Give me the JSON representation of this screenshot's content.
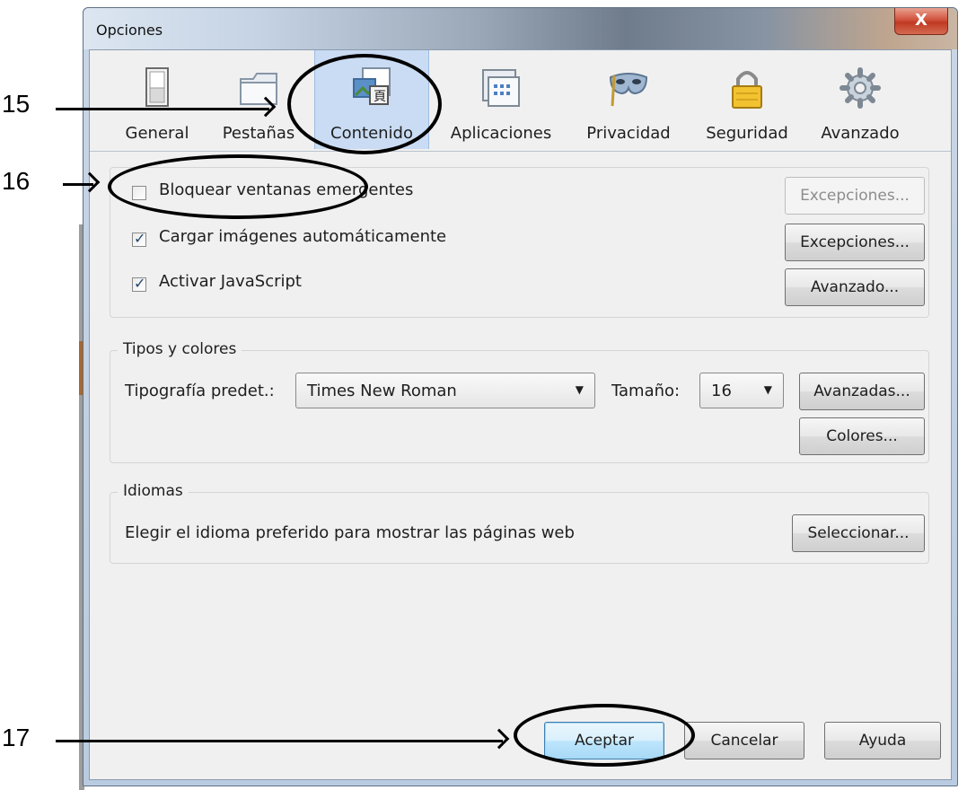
{
  "window": {
    "title": "Opciones",
    "close_glyph": "X"
  },
  "tabs": [
    {
      "label": "General",
      "icon": "general-switch-icon",
      "selected": false
    },
    {
      "label": "Pestañas",
      "icon": "tabs-folder-icon",
      "selected": false
    },
    {
      "label": "Contenido",
      "icon": "content-page-icon",
      "selected": true
    },
    {
      "label": "Aplicaciones",
      "icon": "applications-window-icon",
      "selected": false
    },
    {
      "label": "Privacidad",
      "icon": "privacy-mask-icon",
      "selected": false
    },
    {
      "label": "Seguridad",
      "icon": "security-lock-icon",
      "selected": false
    },
    {
      "label": "Avanzado",
      "icon": "advanced-gear-icon",
      "selected": false
    }
  ],
  "content": {
    "block_popups": {
      "label": "Bloquear ventanas emergentes",
      "checked": false,
      "button": "Excepciones..."
    },
    "load_images": {
      "label": "Cargar imágenes automáticamente",
      "checked": true,
      "button": "Excepciones..."
    },
    "enable_js": {
      "label": "Activar JavaScript",
      "checked": true,
      "button": "Avanzado..."
    }
  },
  "fonts": {
    "legend": "Tipos y colores",
    "default_font_label": "Tipografía predet.:",
    "default_font_value": "Times New Roman",
    "size_label": "Tamaño:",
    "size_value": "16",
    "advanced_button": "Avanzadas...",
    "colors_button": "Colores..."
  },
  "languages": {
    "legend": "Idiomas",
    "description": "Elegir el idioma preferido para mostrar las páginas web",
    "choose_button": "Seleccionar..."
  },
  "footer": {
    "ok": "Aceptar",
    "cancel": "Cancelar",
    "help": "Ayuda"
  },
  "annotations": {
    "n15": "15",
    "n16": "16",
    "n17": "17"
  },
  "colors": {
    "selected_tab": "#c9dcf3",
    "check": "#23466e",
    "dialog_bg": "#f0f0f0"
  }
}
